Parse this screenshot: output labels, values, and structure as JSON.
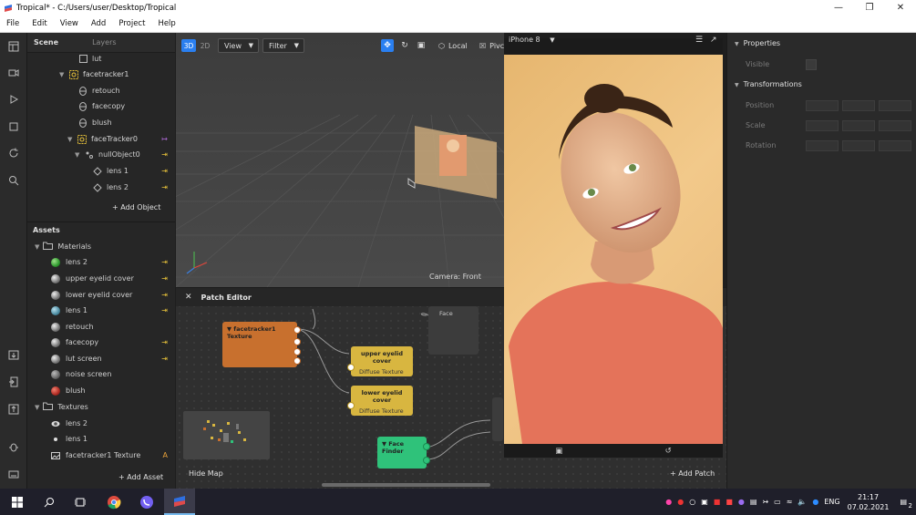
{
  "window": {
    "title": "Tropical* - C:/Users/user/Desktop/Tropical",
    "controls": [
      "minimize",
      "restore",
      "close"
    ]
  },
  "menu": [
    "File",
    "Edit",
    "View",
    "Add",
    "Project",
    "Help"
  ],
  "scene": {
    "tabs": [
      "Scene",
      "Layers"
    ],
    "items": [
      {
        "label": "lut"
      },
      {
        "label": "facetracker1"
      },
      {
        "label": "retouch"
      },
      {
        "label": "facecopy"
      },
      {
        "label": "blush"
      },
      {
        "label": "faceTracker0"
      },
      {
        "label": "nullObject0"
      },
      {
        "label": "lens 1"
      },
      {
        "label": "lens 2"
      }
    ],
    "add_object": "Add Object"
  },
  "assets": {
    "title": "Assets",
    "materials_label": "Materials",
    "materials": [
      "lens 2",
      "upper eyelid cover",
      "lower eyelid cover",
      "lens 1",
      "retouch",
      "facecopy",
      "lut screen",
      "noise screen",
      "blush"
    ],
    "textures_label": "Textures",
    "textures": [
      "lens 2",
      "lens 1",
      "facetracker1 Texture"
    ],
    "texture_badge": "A",
    "add_asset": "Add Asset"
  },
  "viewport": {
    "mode_3d": "3D",
    "mode_2d": "2D",
    "view_dropdown": "View",
    "filter_dropdown": "Filter",
    "local_label": "Local",
    "pivot_label": "Pivc",
    "camera_label": "Camera: Front"
  },
  "simulator": {
    "device": "iPhone 8"
  },
  "patch_editor": {
    "title": "Patch Editor",
    "nodes": {
      "texture": "facetracker1 Texture",
      "upper": "upper eyelid cover",
      "upper_port": "Diffuse Texture",
      "lower": "lower eyelid cover",
      "lower_port": "Diffuse Texture",
      "face": "Face",
      "face_finder": "Face Finder"
    },
    "hide_map": "Hide Map",
    "add_patch": "Add Patch"
  },
  "inspector": {
    "properties": "Properties",
    "visible": "Visible",
    "transformations": "Transformations",
    "position": "Position",
    "scale": "Scale",
    "rotation": "Rotation"
  },
  "taskbar": {
    "language": "ENG",
    "time": "21:17",
    "date": "07.02.2021",
    "notifications": "2"
  },
  "colors": {
    "accent": "#2a7ff0",
    "tracker": "#e8c23a",
    "pin": "#e8c23a",
    "texture_node": "#c8702e",
    "material_node": "#d8b640",
    "finder_node": "#2fc27a"
  }
}
